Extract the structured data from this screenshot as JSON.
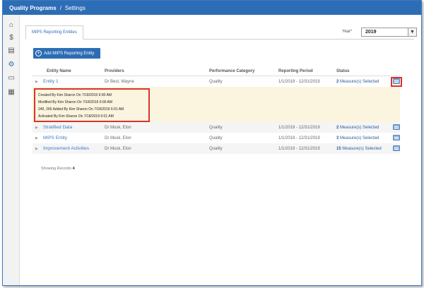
{
  "header": {
    "crumb_main": "Quality Programs",
    "separator": "/",
    "crumb_current": "Settings"
  },
  "sidebar": {
    "items": [
      {
        "icon": "home-icon",
        "glyph": "⌂"
      },
      {
        "icon": "dollar-icon",
        "glyph": "$"
      },
      {
        "icon": "document-icon",
        "glyph": "▤"
      },
      {
        "icon": "gear-icon",
        "glyph": "⚙"
      },
      {
        "icon": "card-icon",
        "glyph": "▭"
      },
      {
        "icon": "report-icon",
        "glyph": "▦"
      }
    ]
  },
  "tab": {
    "label": "MIPS Reporting Entities"
  },
  "year": {
    "label": "Year",
    "required_mark": "*",
    "value": "2019"
  },
  "add_button": {
    "label": "Add MIPS Reporting Entity",
    "plus": "+"
  },
  "table": {
    "headers": {
      "entity": "Entity Name",
      "providers": "Providers",
      "category": "Performance Category",
      "period": "Reporting Period",
      "status": "Status"
    },
    "rows": [
      {
        "name": "Entity 1",
        "provider": "Dr Best, Wayne",
        "category": "Quality",
        "period": "1/1/2019 - 12/31/2019",
        "status_count": "2",
        "status_text": "Measure(s) Selected"
      },
      {
        "name": "Stratified Data",
        "provider": "Dr Musk, Elon",
        "category": "Quality",
        "period": "1/1/2019 - 12/31/2019",
        "status_count": "2",
        "status_text": "Measure(s) Selected"
      },
      {
        "name": "MIPS Entity",
        "provider": "Dr Musk, Elon",
        "category": "Quality",
        "period": "1/1/2019 - 12/31/2019",
        "status_count": "3",
        "status_text": "Measure(s) Selected"
      },
      {
        "name": "Improvement Activities",
        "provider": "Dr Musk, Elon",
        "category": "Quality",
        "period": "1/1/2019 - 12/31/2019",
        "status_count": "15",
        "status_text": "Measure(s) Selected"
      }
    ]
  },
  "details": {
    "lines": [
      "Created By Kim Sharon On 7/18/2019 6:00 AM",
      "Modified By Kim Sharon On 7/18/2019 6:00 AM",
      "249, 265 Added By Kim Sharon On 7/18/2019 6:01 AM",
      "Activated By Kim Sharon On 7/18/2019 6:01 AM"
    ]
  },
  "footer": {
    "label": "Showing Records",
    "count": "4"
  },
  "colors": {
    "brand": "#2d6db5",
    "highlight": "#d9342b",
    "detail_bg": "#fbf4df"
  }
}
